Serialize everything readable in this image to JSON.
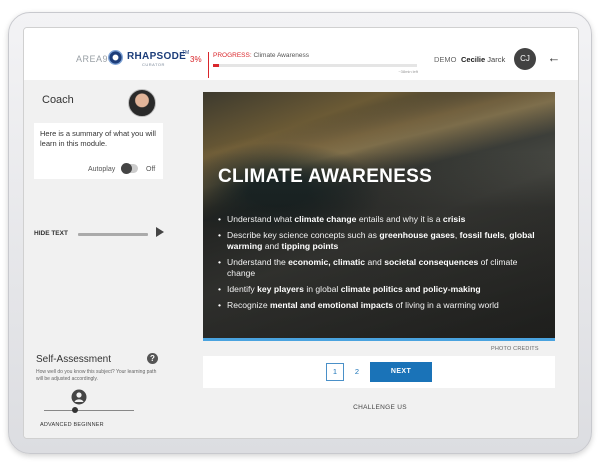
{
  "header": {
    "logo_area9": "AREA9",
    "logo_rhapsode": "RHAPSODE",
    "logo_tm": "TM",
    "logo_curator": "CURATOR",
    "progress_percent": "3%",
    "progress_fraction": 0.03,
    "progress_prefix": "PROGRESS:",
    "progress_title": "Climate Awareness",
    "progress_time": "~38min left",
    "demo_label": "DEMO",
    "user_first": "Cecilie",
    "user_last": "Jarck",
    "avatar_initials": "CJ",
    "back_icon": "arrow-left-icon"
  },
  "coach": {
    "title": "Coach",
    "message": "Here is a summary of what you will learn in this module.",
    "autoplay_label": "Autoplay",
    "autoplay_state": "Off",
    "hide_text_label": "HIDE TEXT"
  },
  "self_assessment": {
    "title": "Self-Assessment",
    "help_icon": "?",
    "description": "How well do you know this subject? Your learning path will be adjusted accordingly.",
    "level_label": "ADVANCED BEGINNER"
  },
  "main": {
    "title": "CLIMATE AWARENESS",
    "bullets": [
      [
        "Understand what ",
        "climate change",
        " entails and why it is a ",
        "crisis",
        ""
      ],
      [
        "Describe key science concepts such as ",
        "greenhouse gases",
        ", ",
        "fossil fuels",
        ", ",
        "global warming",
        " and ",
        "tipping points",
        ""
      ],
      [
        "Understand the ",
        "economic, climatic",
        " and ",
        "societal consequences",
        " of climate change"
      ],
      [
        "Identify ",
        "key players",
        " in global ",
        "climate politics and policy-making",
        ""
      ],
      [
        "Recognize ",
        "mental and emotional impacts",
        " of living in a warming world"
      ]
    ],
    "photo_credits": "PHOTO CREDITS",
    "pages": [
      "1",
      "2"
    ],
    "next_label": "NEXT",
    "challenge_label": "CHALLENGE US"
  },
  "colors": {
    "accent_red": "#d9262b",
    "accent_blue": "#1a73b8",
    "brand_navy": "#1c3d7a"
  }
}
